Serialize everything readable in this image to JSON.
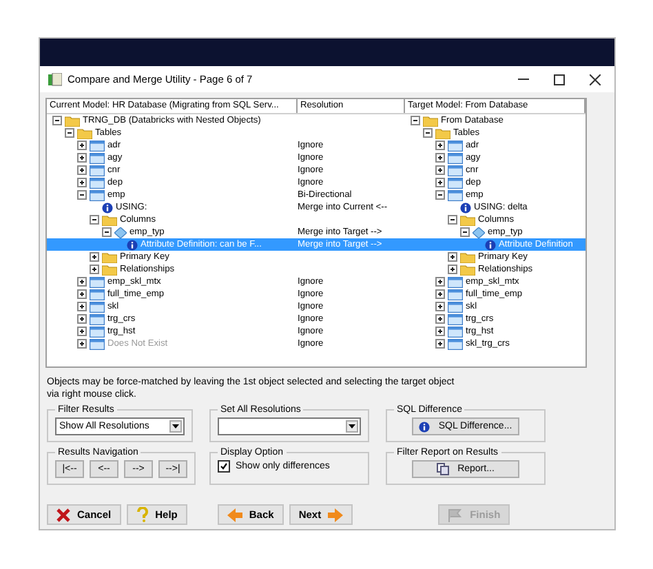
{
  "window": {
    "title": "Compare and Merge Utility  - Page 6 of 7"
  },
  "columns": [
    "Current Model: HR Database (Migrating from SQL Serv...",
    "Resolution",
    "Target Model: From Database"
  ],
  "tree": [
    {
      "label": "TRNG_DB (Databricks with Nested Objects)",
      "kind": "folder",
      "expanded": true,
      "selected": false,
      "greyed": false,
      "target": {
        "label": "From Database"
      },
      "children": [
        {
          "label": "Tables",
          "kind": "folder",
          "expanded": true,
          "selected": false,
          "greyed": false,
          "target": {
            "label": "Tables"
          },
          "children": [
            {
              "label": "adr",
              "kind": "table",
              "expanded": false,
              "selected": false,
              "greyed": false,
              "resolution": "Ignore",
              "target": {
                "label": "adr"
              }
            },
            {
              "label": "agy",
              "kind": "table",
              "expanded": false,
              "selected": false,
              "greyed": false,
              "resolution": "Ignore",
              "target": {
                "label": "agy"
              }
            },
            {
              "label": "cnr",
              "kind": "table",
              "expanded": false,
              "selected": false,
              "greyed": false,
              "resolution": "Ignore",
              "target": {
                "label": "cnr"
              }
            },
            {
              "label": "dep",
              "kind": "table",
              "expanded": false,
              "selected": false,
              "greyed": false,
              "resolution": "Ignore",
              "target": {
                "label": "dep"
              }
            },
            {
              "label": "emp",
              "kind": "table",
              "expanded": true,
              "selected": false,
              "greyed": false,
              "resolution": "Bi-Directional",
              "target": {
                "label": "emp"
              },
              "children": [
                {
                  "label": "USING:",
                  "kind": "info",
                  "selected": false,
                  "greyed": false,
                  "resolution": "Merge into Current <--",
                  "target": {
                    "label": "USING: delta"
                  }
                },
                {
                  "label": "Columns",
                  "kind": "folder",
                  "expanded": true,
                  "selected": false,
                  "greyed": false,
                  "target": {
                    "label": "Columns"
                  },
                  "children": [
                    {
                      "label": "emp_typ",
                      "kind": "column",
                      "expanded": true,
                      "selected": false,
                      "greyed": false,
                      "resolution": "Merge into Target -->",
                      "target": {
                        "label": "emp_typ"
                      },
                      "children": [
                        {
                          "label": "Attribute Definition: can be F...",
                          "kind": "info",
                          "selected": true,
                          "greyed": false,
                          "resolution": "Merge into Target -->",
                          "target": {
                            "label": "Attribute Definition"
                          }
                        }
                      ]
                    }
                  ]
                },
                {
                  "label": "Primary Key",
                  "kind": "folder",
                  "expanded": false,
                  "selected": false,
                  "greyed": false,
                  "target": {
                    "label": "Primary Key"
                  }
                },
                {
                  "label": "Relationships",
                  "kind": "folder",
                  "expanded": false,
                  "selected": false,
                  "greyed": false,
                  "target": {
                    "label": "Relationships"
                  }
                }
              ]
            },
            {
              "label": "emp_skl_mtx",
              "kind": "table",
              "expanded": false,
              "selected": false,
              "greyed": false,
              "resolution": "Ignore",
              "target": {
                "label": "emp_skl_mtx"
              }
            },
            {
              "label": "full_time_emp",
              "kind": "table",
              "expanded": false,
              "selected": false,
              "greyed": false,
              "resolution": "Ignore",
              "target": {
                "label": "full_time_emp"
              }
            },
            {
              "label": "skl",
              "kind": "table",
              "expanded": false,
              "selected": false,
              "greyed": false,
              "resolution": "Ignore",
              "target": {
                "label": "skl"
              }
            },
            {
              "label": "trg_crs",
              "kind": "table",
              "expanded": false,
              "selected": false,
              "greyed": false,
              "resolution": "Ignore",
              "target": {
                "label": "trg_crs"
              }
            },
            {
              "label": "trg_hst",
              "kind": "table",
              "expanded": false,
              "selected": false,
              "greyed": false,
              "resolution": "Ignore",
              "target": {
                "label": "trg_hst"
              }
            },
            {
              "label": "Does Not Exist",
              "kind": "table",
              "expanded": false,
              "selected": false,
              "greyed": true,
              "resolution": "Ignore",
              "target": {
                "label": "skl_trg_crs"
              }
            }
          ]
        }
      ]
    }
  ],
  "note": "Objects may be force-matched by leaving the 1st object selected and selecting the target object via right mouse click.",
  "filter_results": {
    "label": "Filter Results",
    "value": "Show All Resolutions"
  },
  "set_all_resolutions": {
    "label": "Set All Resolutions"
  },
  "sql_difference": {
    "label": "SQL Difference",
    "button": "SQL Difference..."
  },
  "results_navigation": {
    "label": "Results Navigation",
    "buttons": [
      "|<--",
      "<--",
      "-->",
      "-->|"
    ]
  },
  "display_option": {
    "label": "Display Option",
    "checkbox": {
      "label": "Show only differences",
      "checked": true
    }
  },
  "filter_report": {
    "label": "Filter Report on Results",
    "button": "Report..."
  },
  "buttons": [
    {
      "label": "Cancel",
      "kind": "cancel",
      "disabled": false
    },
    {
      "label": "Help",
      "kind": "help",
      "disabled": false
    },
    {
      "label": "Back",
      "kind": "back",
      "disabled": false
    },
    {
      "label": "Next",
      "kind": "next",
      "disabled": false
    },
    {
      "label": "Finish",
      "kind": "finish",
      "disabled": true
    }
  ]
}
